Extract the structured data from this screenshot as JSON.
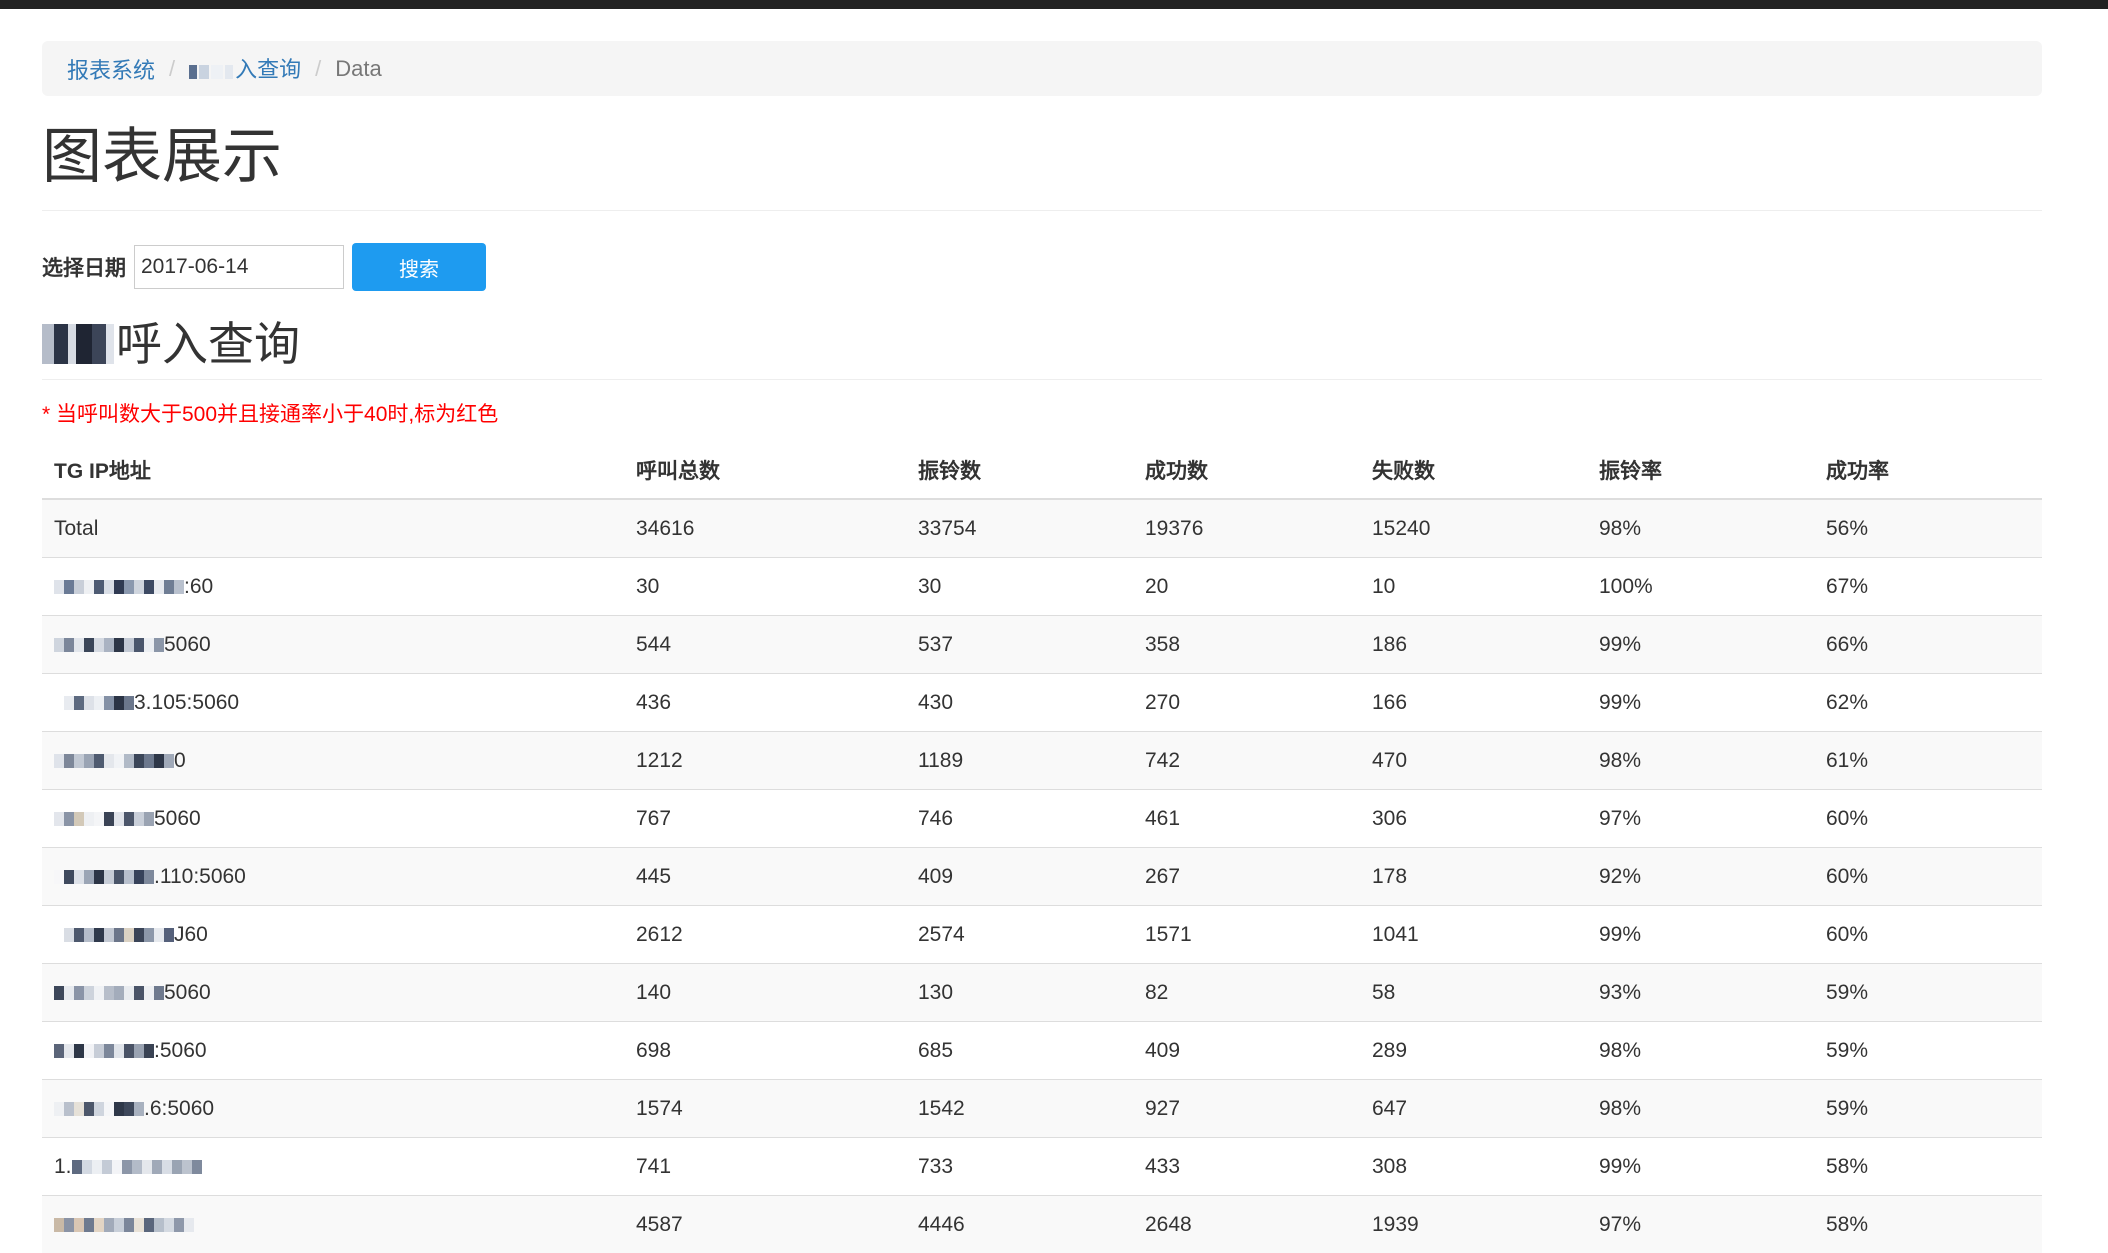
{
  "breadcrumb": {
    "items": [
      {
        "label": "报表系统"
      },
      {
        "label": "入查询"
      }
    ],
    "current": "Data"
  },
  "page_title": "图表展示",
  "search": {
    "label": "选择日期",
    "date_value": "2017-06-14",
    "button_label": "搜索"
  },
  "section_title": "呼入查询",
  "note": "* 当呼叫数大于500并且接通率小于40时,标为红色",
  "table": {
    "headers": [
      "TG IP地址",
      "呼叫总数",
      "振铃数",
      "成功数",
      "失败数",
      "振铃率",
      "成功率"
    ],
    "rows": [
      {
        "ip": "Total",
        "total": "34616",
        "ring": "33754",
        "success": "19376",
        "fail": "15240",
        "ring_rate": "98%",
        "success_rate": "56%"
      },
      {
        "ip": ":60",
        "total": "30",
        "ring": "30",
        "success": "20",
        "fail": "10",
        "ring_rate": "100%",
        "success_rate": "67%"
      },
      {
        "ip": "5060",
        "total": "544",
        "ring": "537",
        "success": "358",
        "fail": "186",
        "ring_rate": "99%",
        "success_rate": "66%"
      },
      {
        "ip": "3.105:5060",
        "total": "436",
        "ring": "430",
        "success": "270",
        "fail": "166",
        "ring_rate": "99%",
        "success_rate": "62%"
      },
      {
        "ip": "0",
        "total": "1212",
        "ring": "1189",
        "success": "742",
        "fail": "470",
        "ring_rate": "98%",
        "success_rate": "61%"
      },
      {
        "ip": "5060",
        "total": "767",
        "ring": "746",
        "success": "461",
        "fail": "306",
        "ring_rate": "97%",
        "success_rate": "60%"
      },
      {
        "ip": ".110:5060",
        "total": "445",
        "ring": "409",
        "success": "267",
        "fail": "178",
        "ring_rate": "92%",
        "success_rate": "60%"
      },
      {
        "ip": "J60",
        "total": "2612",
        "ring": "2574",
        "success": "1571",
        "fail": "1041",
        "ring_rate": "99%",
        "success_rate": "60%"
      },
      {
        "ip": "5060",
        "total": "140",
        "ring": "130",
        "success": "82",
        "fail": "58",
        "ring_rate": "93%",
        "success_rate": "59%"
      },
      {
        "ip": ":5060",
        "total": "698",
        "ring": "685",
        "success": "409",
        "fail": "289",
        "ring_rate": "98%",
        "success_rate": "59%"
      },
      {
        "ip": ".6:5060",
        "total": "1574",
        "ring": "1542",
        "success": "927",
        "fail": "647",
        "ring_rate": "98%",
        "success_rate": "59%"
      },
      {
        "ip": "1.",
        "total": "741",
        "ring": "733",
        "success": "433",
        "fail": "308",
        "ring_rate": "99%",
        "success_rate": "58%"
      },
      {
        "ip": "",
        "total": "4587",
        "ring": "4446",
        "success": "2648",
        "fail": "1939",
        "ring_rate": "97%",
        "success_rate": "58%"
      }
    ]
  },
  "colors": {
    "link": "#337ab7",
    "button": "#1e9bf0",
    "note": "#ff0000",
    "stripe": "#f9f9f9"
  }
}
